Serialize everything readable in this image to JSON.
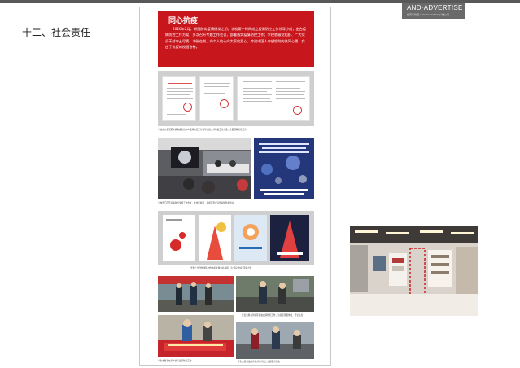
{
  "header": {
    "logo_main": "AND·ADVERTISE",
    "logo_sub": "经营与管理 ANDADVERTISE 广告公司"
  },
  "section": {
    "title": "十二、社会责任"
  },
  "poster": {
    "banner_title": "同心抗疫",
    "banner_text": "2020年2月，新冠肺炎疫情爆发之初，学校第一时间成立疫情防控工作领导小组，出台疫情防控工作方案，多次召开专题工作会议，部署落实疫情防控工作；学校各级党组织、广大党员干部守土尽责、冲锐在前，向个人的心向大家的爱心，传递中国人守望相助的共同心愿，交出了抗疫的校园答卷。",
    "captions": [
      "学校成立新型冠状病毒感染的肺炎疫情防控工作领导小组，并印发工作方案，全面部署防控工作",
      "学校部门召开疫情防控专题工作会议，并用黑板报、海报等形式宣传疫情防控知识",
      "学生广告创作团队创作抗疫主题公益海报，为“同心抗疫”贡献力量",
      "党员志愿者到社区参加疫情防控工作，为居民测量体温、登记信息",
      "学生志愿者在家乡参与疫情防控工作",
      "学生志愿者绩效考核并参与线上志愿服务活动"
    ]
  },
  "colors": {
    "accent_red": "#c8161d",
    "panel_grey": "#cfcfcf",
    "topbar": "#585858"
  }
}
